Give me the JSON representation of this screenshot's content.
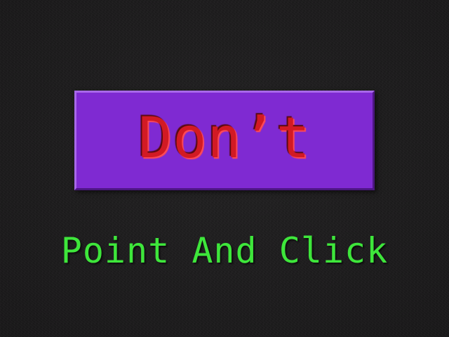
{
  "game": {
    "button_label": "Don’t",
    "subtitle": "Point And Click"
  },
  "colors": {
    "background": "#1c1b1c",
    "button_fill": "#7f2ad2",
    "button_text": "#d21a24",
    "subtitle_text": "#3ee63b"
  }
}
